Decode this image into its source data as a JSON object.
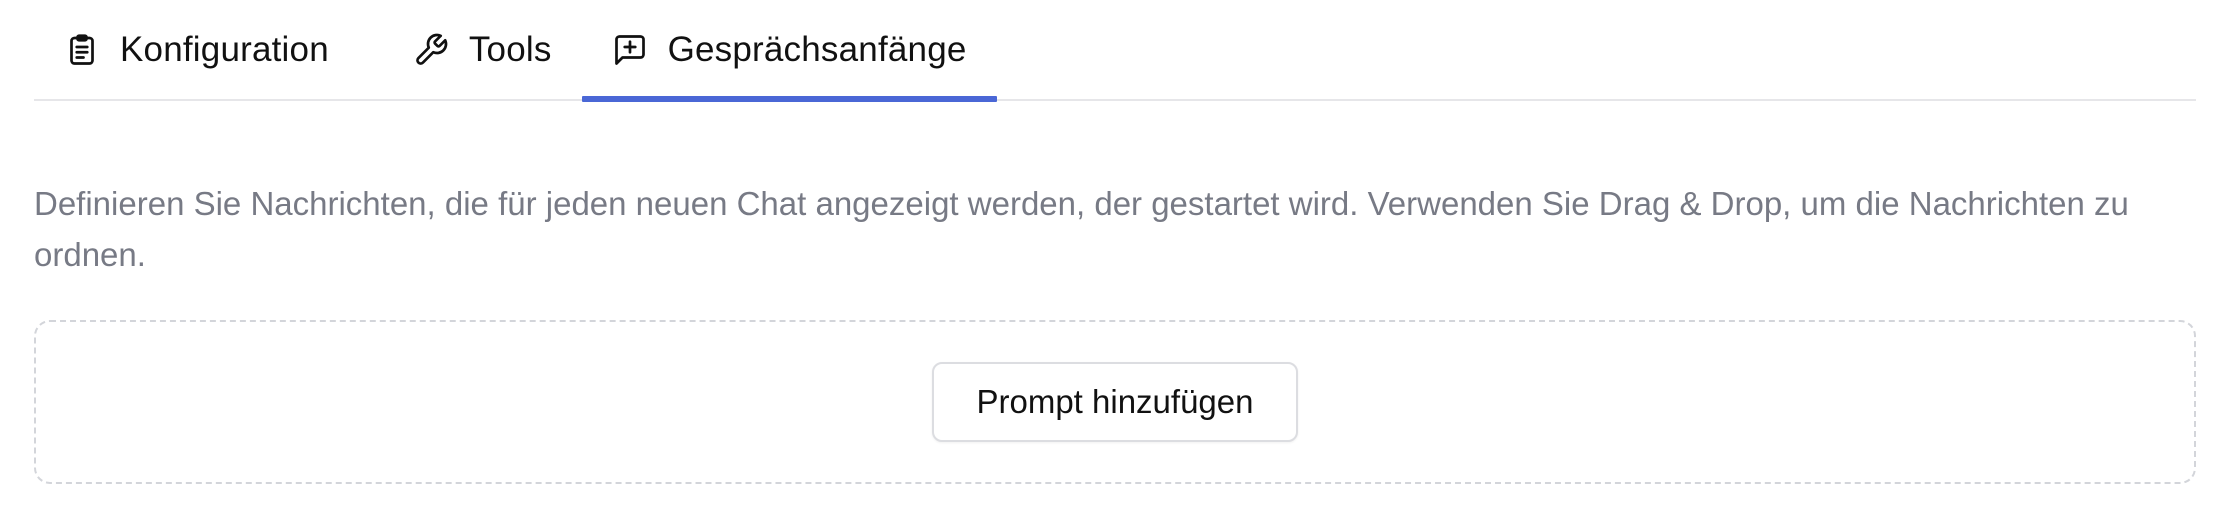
{
  "tabs": [
    {
      "label": "Konfiguration",
      "icon": "clipboard-list-icon",
      "active": false
    },
    {
      "label": "Tools",
      "icon": "wrench-icon",
      "active": false
    },
    {
      "label": "Gesprächsanfänge",
      "icon": "message-square-plus-icon",
      "active": true
    }
  ],
  "description": "Definieren Sie Nachrichten, die für jeden neuen Chat angezeigt werden, der gestartet wird. Verwenden Sie Drag & Drop, um die Nachrichten zu ordnen.",
  "add_prompt_button": {
    "label": "Prompt hinzufügen"
  },
  "colors": {
    "active_tab_indicator": "#4a67d6",
    "description_text": "#777a85",
    "divider": "#e6e6e9",
    "dropzone_border": "#d3d5da"
  }
}
